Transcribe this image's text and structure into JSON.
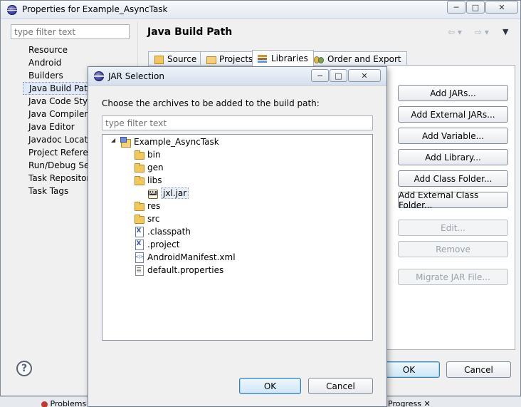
{
  "properties_window": {
    "title": "Properties for Example_AsyncTask",
    "filter_placeholder": "type filter text",
    "nav_items": [
      {
        "label": "Resource",
        "selected": false
      },
      {
        "label": "Android",
        "selected": false
      },
      {
        "label": "Builders",
        "selected": false
      },
      {
        "label": "Java Build Path",
        "selected": true
      },
      {
        "label": "Java Code Style",
        "selected": false
      },
      {
        "label": "Java Compiler",
        "selected": false
      },
      {
        "label": "Java Editor",
        "selected": false
      },
      {
        "label": "Javadoc Location",
        "selected": false
      },
      {
        "label": "Project References",
        "selected": false
      },
      {
        "label": "Run/Debug Settings",
        "selected": false
      },
      {
        "label": "Task Repository",
        "selected": false
      },
      {
        "label": "Task Tags",
        "selected": false
      }
    ],
    "page_title": "Java Build Path",
    "tabs": [
      {
        "label": "Source",
        "icon": "source-folder-icon",
        "active": false
      },
      {
        "label": "Projects",
        "icon": "projects-icon",
        "active": false
      },
      {
        "label": "Libraries",
        "icon": "libraries-icon",
        "active": true
      },
      {
        "label": "Order and Export",
        "icon": "order-export-icon",
        "active": false
      }
    ],
    "buttons": {
      "add_jars": "Add JARs...",
      "add_external_jars": "Add External JARs...",
      "add_variable": "Add Variable...",
      "add_library": "Add Library...",
      "add_class_folder": "Add Class Folder...",
      "add_external_class_folder": "Add External Class Folder...",
      "edit": "Edit...",
      "remove": "Remove",
      "migrate_jar": "Migrate JAR File..."
    },
    "ok_label": "OK",
    "cancel_label": "Cancel",
    "help_glyph": "?"
  },
  "jar_dialog": {
    "title": "JAR Selection",
    "prompt": "Choose the archives to be added to the build path:",
    "filter_placeholder": "type filter text",
    "tree": [
      {
        "label": "Example_AsyncTask",
        "icon": "project-icon",
        "depth": 0,
        "expand": "◢"
      },
      {
        "label": "bin",
        "icon": "folder-icon",
        "depth": 1
      },
      {
        "label": "gen",
        "icon": "folder-icon",
        "depth": 1
      },
      {
        "label": "libs",
        "icon": "folder-icon",
        "depth": 1
      },
      {
        "label": "jxl.jar",
        "icon": "jar-icon",
        "depth": 2,
        "selected": true
      },
      {
        "label": "res",
        "icon": "folder-icon",
        "depth": 1
      },
      {
        "label": "src",
        "icon": "folder-icon",
        "depth": 1
      },
      {
        "label": ".classpath",
        "icon": "xfile-icon",
        "depth": 1
      },
      {
        "label": ".project",
        "icon": "xfile-icon",
        "depth": 1
      },
      {
        "label": "AndroidManifest.xml",
        "icon": "manifest-icon",
        "depth": 1
      },
      {
        "label": "default.properties",
        "icon": "file-icon",
        "depth": 1
      }
    ],
    "ok_label": "OK",
    "cancel_label": "Cancel"
  },
  "bottom_tabs": {
    "problems": "Problems",
    "progress": "Progress"
  },
  "window_controls": {
    "minimize": "─",
    "maximize": "□",
    "close": "✕"
  }
}
